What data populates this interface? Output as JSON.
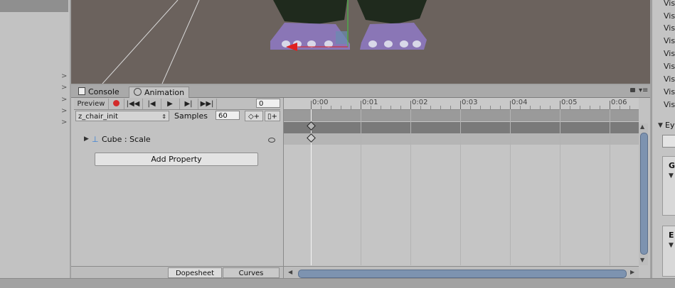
{
  "tabs": {
    "console": "Console",
    "animation": "Animation"
  },
  "controls": {
    "preview": "Preview",
    "frame_value": "0",
    "clip_name": "z_chair_init",
    "samples_label": "Samples",
    "samples_value": "60",
    "property_label": "Cube : Scale",
    "add_property": "Add Property",
    "view_dopesheet": "Dopesheet",
    "view_curves": "Curves"
  },
  "timeline": {
    "ticks": [
      "0:00",
      "0:01",
      "0:02",
      "0:03",
      "0:04",
      "0:05",
      "0:06"
    ]
  },
  "inspector": {
    "visible_items": [
      "Vis",
      "Vis",
      "Vis",
      "Vis",
      "Vis",
      "Vis",
      "Vis",
      "Vis",
      "Vis"
    ],
    "section_eye": "Ey",
    "section_g": "G",
    "section_e": "E"
  },
  "colors": {
    "record_red": "#d32b2b",
    "scroll_blue": "#7d93b0",
    "scene_bg": "#6b625d"
  }
}
